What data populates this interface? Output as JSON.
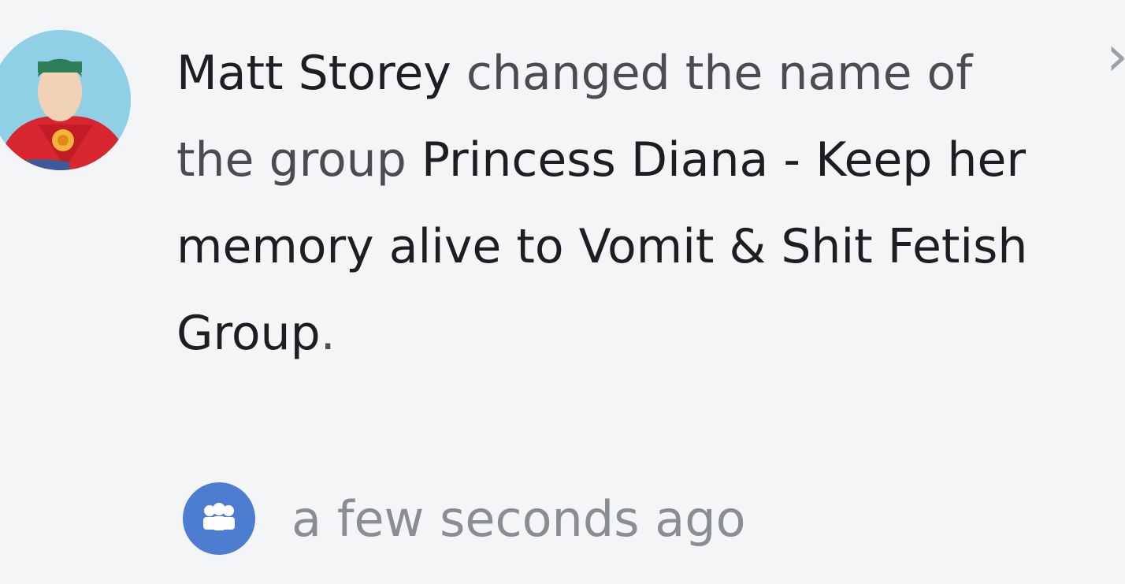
{
  "notification": {
    "actor": "Matt Storey",
    "action_text": " changed the name of the group ",
    "new_group_name": "Princess Diana - Keep her memory alive to Vomit & Shit Fetish Group",
    "trailing_period": ".",
    "timestamp": "a few seconds ago",
    "group_icon": "group-icon",
    "avatar_icon": "superhero-avatar",
    "colors": {
      "badge": "#4d7dd0",
      "avatar_bg": "#8fd0e6"
    }
  }
}
